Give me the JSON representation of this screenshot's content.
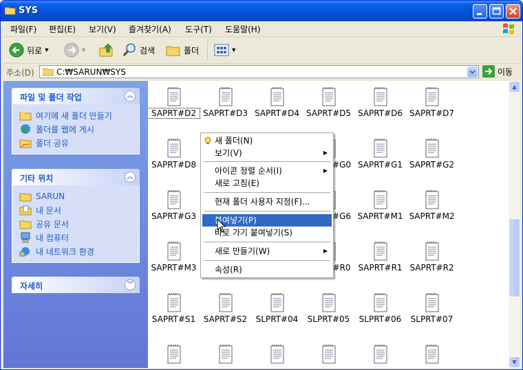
{
  "window": {
    "title": "SYS"
  },
  "menu": [
    "파일(F)",
    "편집(E)",
    "보기(V)",
    "즐겨찾기(A)",
    "도구(T)",
    "도움말(H)"
  ],
  "toolbar": {
    "back": "뒤로",
    "search": "검색",
    "folders": "폴더"
  },
  "address": {
    "label": "주소(D)",
    "value": "C:₩SARUN₩SYS",
    "go": "이동"
  },
  "tasks": {
    "title": "파일 및 폴더 작업",
    "items": [
      "여기에 새 폴더 만들기",
      "폴더를 웹에 게시",
      "폴더 공유"
    ]
  },
  "places": {
    "title": "기타 위치",
    "items": [
      "SARUN",
      "내 문서",
      "공유 문서",
      "내 컴퓨터",
      "내 네트워크 환경"
    ]
  },
  "details": {
    "title": "자세히"
  },
  "files": [
    "SAPRT#D2",
    "SAPRT#D3",
    "SAPRT#D4",
    "SAPRT#D5",
    "SAPRT#D6",
    "SAPRT#D7",
    "SAPRT#D8",
    "",
    "",
    "SAPRT#G0",
    "SAPRT#G1",
    "SAPRT#G2",
    "SAPRT#G3",
    "",
    "",
    "SAPRT#G6",
    "SAPRT#M1",
    "SAPRT#M2",
    "SAPRT#M3",
    "",
    "",
    "SAPRT#R0",
    "SAPRT#R1",
    "SAPRT#R2",
    "SAPRT#S1",
    "SAPRT#S2",
    "SLPRT#04",
    "SLPRT#05",
    "SLPRT#06",
    "SLPRT#07",
    "",
    "",
    "",
    "",
    "",
    ""
  ],
  "context_menu": {
    "items": [
      "새 폴더(N)",
      "보기(V)",
      "아이콘 정렬 순서(I)",
      "새로 고침(E)",
      "현재 폴더 사용자 지정(F)...",
      "붙여넣기(P)",
      "바로 가기 붙여넣기(S)",
      "새로 만들기(W)",
      "속성(R)"
    ],
    "selected": "붙여넣기(P)"
  },
  "colors": {
    "titlebar": "#0550DA",
    "selection": "#316AC5",
    "task_link": "#215DC6"
  }
}
